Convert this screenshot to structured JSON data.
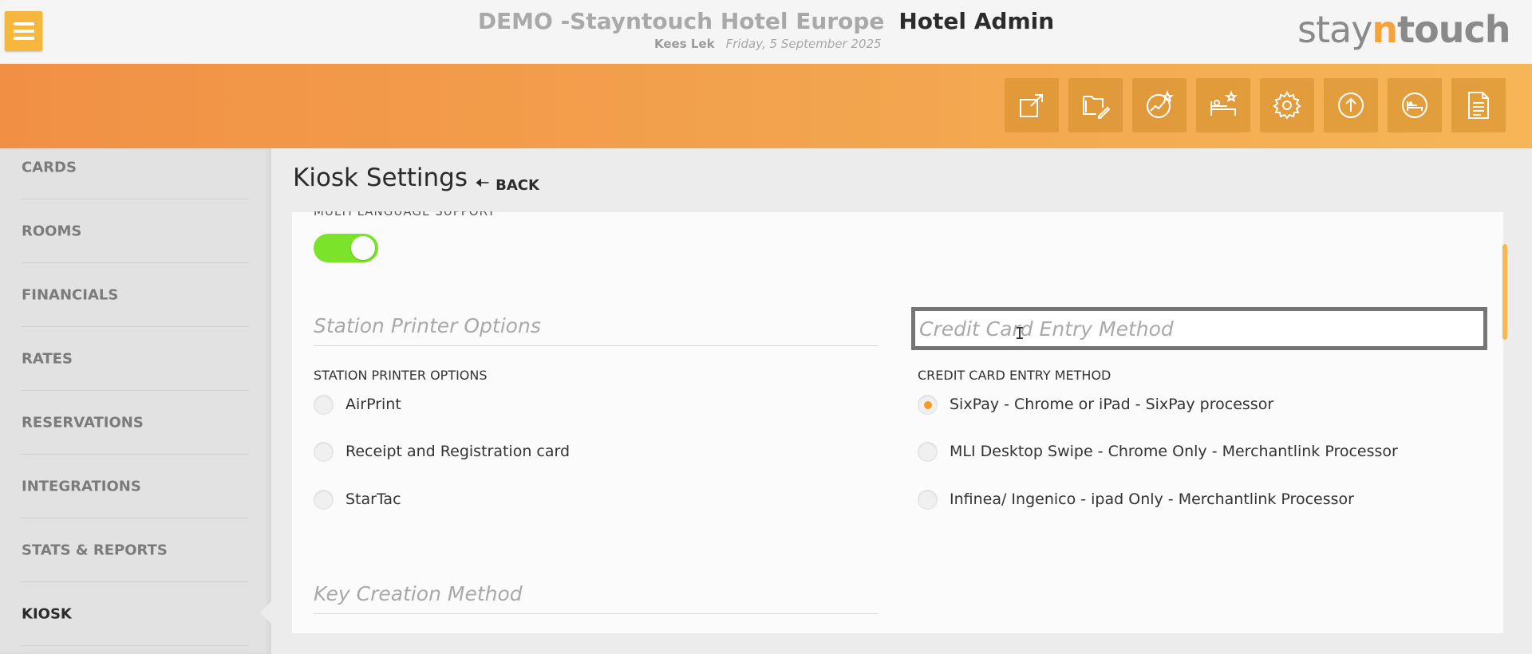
{
  "header": {
    "hotel_name": "DEMO -Stayntouch Hotel Europe",
    "app_title": "Hotel Admin",
    "user_name": "Kees Lek",
    "date": "Friday, 5 September 2025",
    "logo": {
      "part1": "stay",
      "part2": "n",
      "part3": "touch"
    },
    "menu_icon": "hamburger-icon",
    "toolbar_icons": [
      "external-link-icon",
      "folder-edit-icon",
      "chart-star-icon",
      "bed-star-icon",
      "gear-icon",
      "upload-circle-icon",
      "bed-circle-icon",
      "document-icon"
    ]
  },
  "colors": {
    "accent": "#f6b73c",
    "band_start": "#f19045",
    "band_end": "#f6b657",
    "toggle_on": "#7ae32a",
    "radio_selected": "#f59a23"
  },
  "sidebar": {
    "items": [
      {
        "label": "CARDS"
      },
      {
        "label": "ROOMS"
      },
      {
        "label": "FINANCIALS"
      },
      {
        "label": "RATES"
      },
      {
        "label": "RESERVATIONS"
      },
      {
        "label": "INTEGRATIONS"
      },
      {
        "label": "STATS & REPORTS"
      },
      {
        "label": "KIOSK",
        "active": true
      }
    ]
  },
  "main": {
    "title": "Kiosk Settings",
    "back_label": "BACK",
    "multi_language_label": "MULTI LANGUAGE SUPPORT",
    "multi_language_enabled": true,
    "station_printer": {
      "section_title": "Station Printer Options",
      "group_label": "STATION PRINTER OPTIONS",
      "options": [
        "AirPrint",
        "Receipt and Registration card",
        "StarTac"
      ],
      "selected": null
    },
    "credit_card": {
      "section_title": "Credit Card Entry Method",
      "group_label": "CREDIT CARD ENTRY METHOD",
      "options": [
        "SixPay - Chrome or iPad - SixPay processor",
        "MLI Desktop Swipe - Chrome Only - Merchantlink Processor",
        "Infinea/ Ingenico - ipad Only - Merchantlink Processor"
      ],
      "selected": "SixPay - Chrome or iPad - SixPay processor"
    },
    "key_creation": {
      "section_title": "Key Creation Method"
    }
  }
}
